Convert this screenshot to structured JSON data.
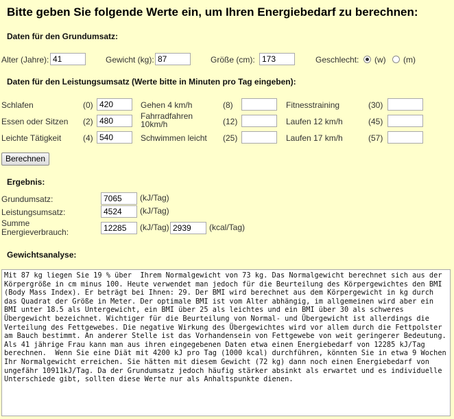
{
  "title": "Bitte geben Sie folgende Werte ein, um Ihren Energiebedarf zu berechnen:",
  "grundumsatz": {
    "heading": "Daten für den Grundumsatz:",
    "age_label": "Alter (Jahre):",
    "age_value": "41",
    "weight_label": "Gewicht (kg):",
    "weight_value": "87",
    "height_label": "Größe (cm):",
    "height_value": "173",
    "gender_label": "Geschlecht:",
    "gender_w": "(w)",
    "gender_m": "(m)",
    "gender_selected": "w"
  },
  "leistung": {
    "heading": "Daten für den Leistungsumsatz (Werte bitte in Minuten pro Tag eingeben):",
    "col1": [
      {
        "label": "Schlafen",
        "factor": "(0)",
        "value": "420"
      },
      {
        "label": "Essen oder Sitzen",
        "factor": "(2)",
        "value": "480"
      },
      {
        "label": "Leichte Tätigkeit",
        "factor": "(4)",
        "value": "540"
      }
    ],
    "col2": [
      {
        "label": "Gehen 4 km/h",
        "factor": "(8)",
        "value": ""
      },
      {
        "label": "Fahrradfahren 10km/h",
        "factor": "(12)",
        "value": ""
      },
      {
        "label": "Schwimmen leicht",
        "factor": "(25)",
        "value": ""
      }
    ],
    "col3": [
      {
        "label": "Fitnesstraining",
        "factor": "(30)",
        "value": ""
      },
      {
        "label": "Laufen 12 km/h",
        "factor": "(45)",
        "value": ""
      },
      {
        "label": "Laufen 17 km/h",
        "factor": "(57)",
        "value": ""
      }
    ]
  },
  "button_label": "Berechnen",
  "ergebnis": {
    "heading": "Ergebnis:",
    "grund_label": "Grundumsatz:",
    "grund_value": "7065",
    "grund_unit": "(kJ/Tag)",
    "leist_label": "Leistungsumsatz:",
    "leist_value": "4524",
    "leist_unit": "(kJ/Tag)",
    "summe_label_1": "Summe",
    "summe_label_2": "Energieverbrauch:",
    "summe_value_kj": "12285",
    "summe_unit_kj": "(kJ/Tag)",
    "summe_value_kcal": "2939",
    "summe_unit_kcal": "(kcal/Tag)"
  },
  "analyse": {
    "heading": "Gewichtsanalyse:",
    "text": "Mit 87 kg liegen Sie 19 % über  Ihrem Normalgewicht von 73 kg. Das Normalgewicht berechnet sich aus der Körpergröße in cm minus 100. Heute verwendet man jedoch für die Beurteilung des Körpergewichtes den BMI (Body Mass Index). Er beträgt bei Ihnen: 29. Der BMI wird berechnet aus dem Körpergewicht in kg durch das Quadrat der Größe in Meter. Der optimale BMI ist vom Alter abhängig, im allgemeinen wird aber ein BMI unter 18.5 als Untergewicht, ein BMI über 25 als leichtes und ein BMI über 30 als schweres Übergewicht bezeichnet. Wichtiger für die Beurteilung von Normal- und Übergewicht ist allerdings die Verteilung des Fettgewebes. Die negative Wirkung des Übergewichtes wird vor allem durch die Fettpolster am Bauch bestimmt. An anderer Stelle ist das Vorhandensein von Fettgewebe von weit geringerer Bedeutung. Als 41 jährige Frau kann man aus ihren eingegebenen Daten etwa einen Energiebedarf von 12285 kJ/Tag berechnen.  Wenn Sie eine Diät mit 4200 kJ pro Tag (1000 kcal) durchführen, könnten Sie in etwa 9 Wochen Ihr Normalgewicht erreichen. Sie hätten mit diesem Gewicht (72 kg) dann noch einen Energiebedarf von ungefähr 10911kJ/Tag. Da der Grundumsatz jedoch häufig stärker absinkt als erwartet und es individuelle Unterschiede gibt, sollten diese Werte nur als Anhaltspunkte dienen."
  }
}
